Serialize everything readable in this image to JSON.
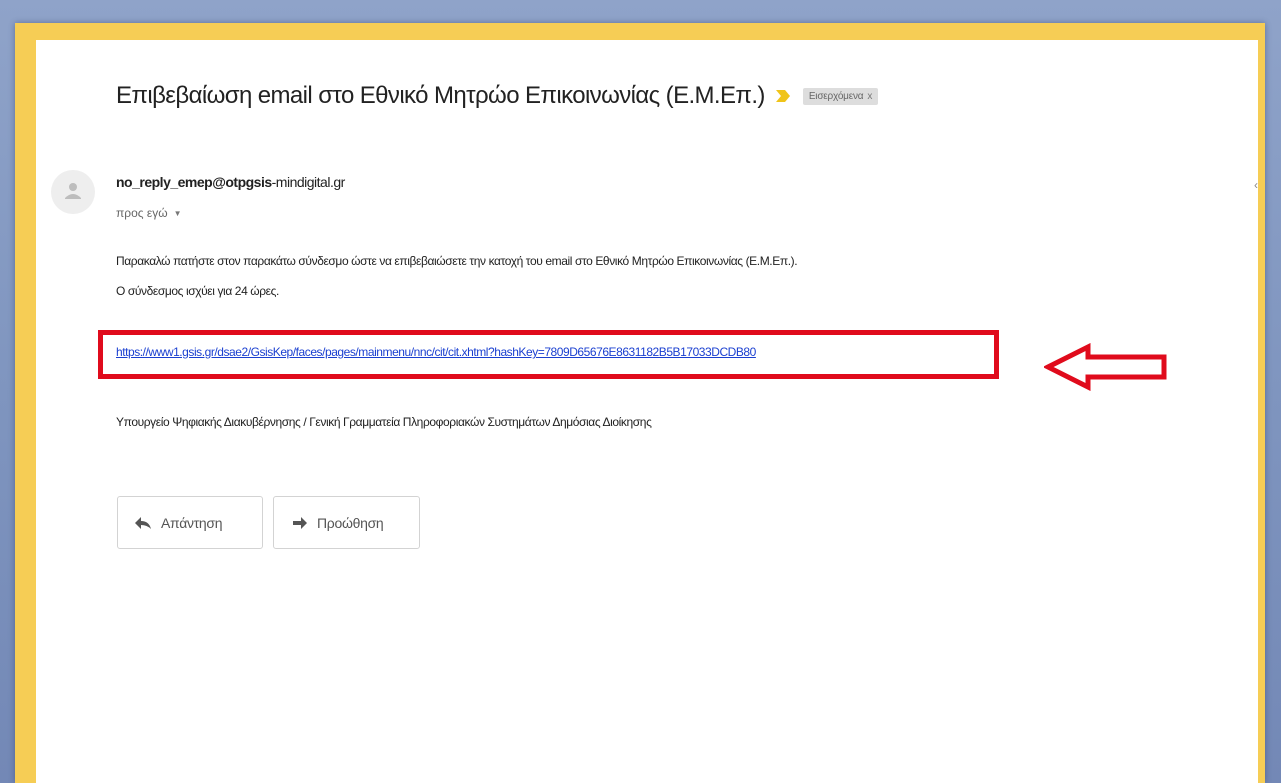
{
  "email": {
    "subject": "Επιβεβαίωση email στο Εθνικό Μητρώο Επικοινωνίας (Ε.Μ.Επ.)",
    "label": "Εισερχόμενα",
    "label_remove": "x",
    "sender_user": "no_reply_emep@otpgsis",
    "sender_domain": "-mindigital.gr",
    "recipient": "προς εγώ",
    "body_line1": "Παρακαλώ πατήστε στον παρακάτω σύνδεσμο ώστε να επιβεβαιώσετε την κατοχή του email στο Εθνικό Μητρώο Επικοινωνίας (Ε.Μ.Επ.).",
    "body_line2": "Ο σύνδεσμος ισχύει για 24 ώρες.",
    "verification_link": "https://www1.gsis.gr/dsae2/GsisKep/faces/pages/mainmenu/nnc/cit/cit.xhtml?hashKey=7809D65676E8631182B5B17033DCDB80",
    "signature": "Υπουργείο Ψηφιακής Διακυβέρνησης / Γενική Γραμματεία Πληροφοριακών Συστημάτων Δημόσιας Διοίκησης",
    "right_edge_glyph": "‹"
  },
  "actions": {
    "reply_label": "Απάντηση",
    "forward_label": "Προώθηση"
  },
  "colors": {
    "frame_yellow": "#f6cd55",
    "highlight_red": "#e00b1c",
    "link_blue": "#1a3fd0",
    "background_blue": "#8fa3c9"
  },
  "icons": {
    "importance": "importance-marker-icon",
    "avatar": "person-icon",
    "recipient_caret": "chevron-down-icon",
    "reply": "reply-icon",
    "forward": "forward-icon",
    "annotation": "left-arrow-icon"
  }
}
